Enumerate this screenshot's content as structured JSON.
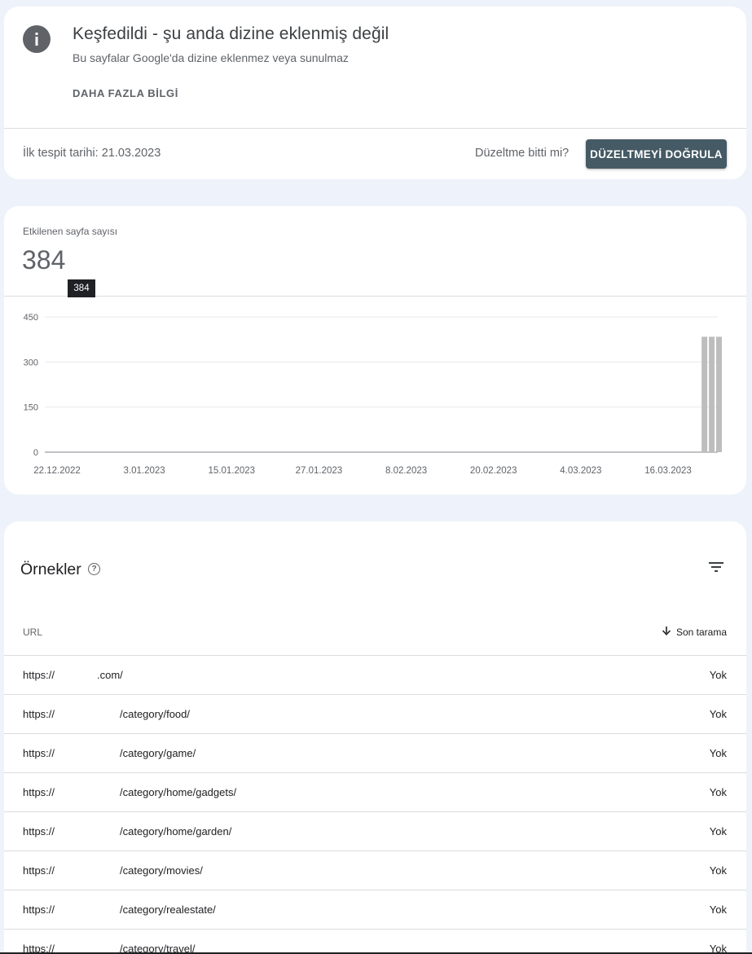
{
  "issue": {
    "title": "Keşfedildi - şu anda dizine eklenmiş değil",
    "subtitle": "Bu sayfalar Google'da dizine eklenmez veya sunulmaz",
    "learn_more": "DAHA FAZLA BİLGİ",
    "first_detected": "İlk tespit tarihi: 21.03.2023",
    "fix_question": "Düzeltme bitti mi?",
    "validate_button": "DÜZELTMEYİ DOĞRULA"
  },
  "metric": {
    "label": "Etkilenen sayfa sayısı",
    "value": "384",
    "tooltip": "384"
  },
  "chart_data": {
    "type": "bar",
    "y_ticks": [
      "450",
      "300",
      "150",
      "0"
    ],
    "x_ticks": [
      "22.12.2022",
      "3.01.2023",
      "15.01.2023",
      "27.01.2023",
      "8.02.2023",
      "20.02.2023",
      "4.03.2023",
      "16.03.2023"
    ],
    "ylim": [
      0,
      450
    ],
    "series": [
      {
        "values": [
          {
            "x": "21.03.2023",
            "y": 384
          },
          {
            "x": "22.03.2023",
            "y": 384
          },
          {
            "x": "23.03.2023",
            "y": 384
          }
        ]
      }
    ],
    "bar_color": "#bdbdbd"
  },
  "examples": {
    "title": "Örnekler",
    "col_url": "URL",
    "col_last_crawl": "Son tarama",
    "rows": [
      {
        "prefix": "https://",
        "path": ".com/",
        "last_crawl": "Yok"
      },
      {
        "prefix": "https://",
        "path": "/category/food/",
        "last_crawl": "Yok"
      },
      {
        "prefix": "https://",
        "path": "/category/game/",
        "last_crawl": "Yok"
      },
      {
        "prefix": "https://",
        "path": "/category/home/gadgets/",
        "last_crawl": "Yok"
      },
      {
        "prefix": "https://",
        "path": "/category/home/garden/",
        "last_crawl": "Yok"
      },
      {
        "prefix": "https://",
        "path": "/category/movies/",
        "last_crawl": "Yok"
      },
      {
        "prefix": "https://",
        "path": "/category/realestate/",
        "last_crawl": "Yok"
      },
      {
        "prefix": "https://",
        "path": "/category/travel/",
        "last_crawl": "Yok"
      }
    ]
  }
}
